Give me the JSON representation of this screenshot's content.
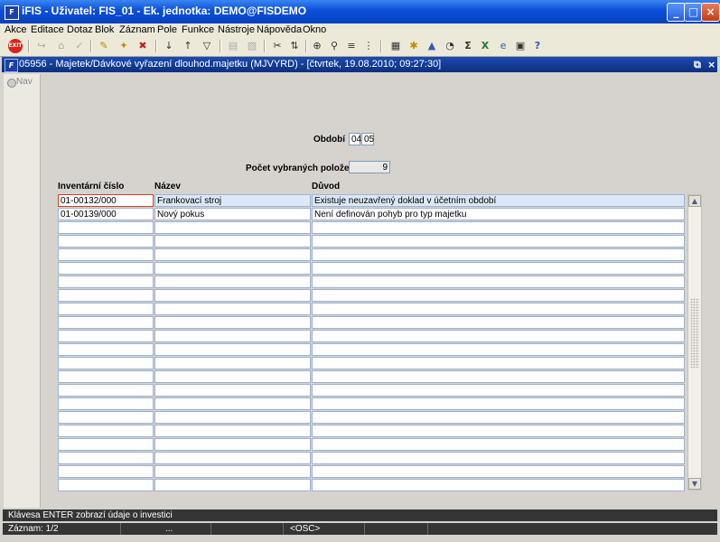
{
  "window": {
    "title": "iFIS - Uživatel: FIS_01 - Ek. jednotka: DEMO@FISDEMO"
  },
  "menu": [
    "Akce",
    "Editace",
    "Dotaz",
    "Blok",
    "Záznam",
    "Pole",
    "Funkce",
    "Nástroje",
    "Nápověda",
    "Okno"
  ],
  "toolbar": {
    "exit_label": "EXIT"
  },
  "form": {
    "title": "05956 - Majetek/Dávkové vyřazení dlouhod.majetku (MJVYRD) - [čtvrtek, 19.08.2010; 09:27:30]",
    "nav_label": "Nav",
    "period_label": "Období",
    "period_month": "04",
    "period_year": "05",
    "count_label": "Počet vybraných položek",
    "count_value": "9"
  },
  "table": {
    "headers": [
      "Inventární číslo",
      "Název",
      "Důvod"
    ],
    "rows": [
      [
        "01-00132/000",
        "Frankovací stroj",
        "Existuje neuzavřený doklad v účetním období"
      ],
      [
        "01-00139/000",
        "Nový pokus",
        "Není definován pohyb pro typ majetku"
      ],
      [
        "",
        "",
        ""
      ],
      [
        "",
        "",
        ""
      ],
      [
        "",
        "",
        ""
      ],
      [
        "",
        "",
        ""
      ],
      [
        "",
        "",
        ""
      ],
      [
        "",
        "",
        ""
      ],
      [
        "",
        "",
        ""
      ],
      [
        "",
        "",
        ""
      ],
      [
        "",
        "",
        ""
      ],
      [
        "",
        "",
        ""
      ],
      [
        "",
        "",
        ""
      ],
      [
        "",
        "",
        ""
      ],
      [
        "",
        "",
        ""
      ],
      [
        "",
        "",
        ""
      ],
      [
        "",
        "",
        ""
      ],
      [
        "",
        "",
        ""
      ],
      [
        "",
        "",
        ""
      ],
      [
        "",
        "",
        ""
      ],
      [
        "",
        "",
        ""
      ],
      [
        "",
        "",
        ""
      ]
    ]
  },
  "status": {
    "message": "Klávesa ENTER zobrazí údaje o investici",
    "record": "Záznam: 1/2",
    "dots": "...",
    "mode": "<OSC>"
  }
}
